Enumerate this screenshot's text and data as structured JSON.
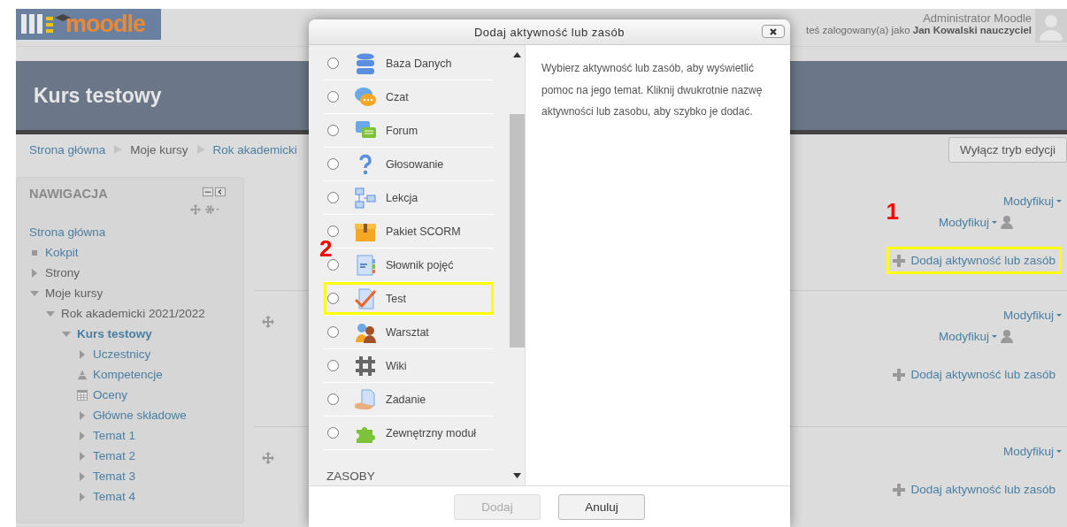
{
  "header": {
    "logo_text": "moodle",
    "user_role": "Administrator Moodle",
    "login_info": "teś zalogowany(a) jako **Jan Kowalski nauczyciel**"
  },
  "course": {
    "title": "Kurs testowy"
  },
  "breadcrumb": [
    {
      "label": "Strona główna",
      "link": true
    },
    {
      "label": "Moje kursy",
      "link": false
    },
    {
      "label": "Rok akademicki",
      "link": true
    }
  ],
  "edit_button": "Wyłącz tryb edycji",
  "navigation": {
    "title": "NAWIGACJA",
    "items": [
      {
        "label": "Strona główna",
        "kind": "plain",
        "link": true
      },
      {
        "label": "Kokpit",
        "kind": "bullet",
        "link": true
      },
      {
        "label": "Strony",
        "kind": "branch",
        "link": false,
        "expanded": false
      },
      {
        "label": "Moje kursy",
        "kind": "branch",
        "link": false,
        "expanded": true,
        "children": [
          {
            "label": "Rok akademicki 2021/2022",
            "kind": "branch",
            "link": false,
            "expanded": true,
            "children": [
              {
                "label": "Kurs testowy",
                "kind": "branch",
                "link": true,
                "expanded": true,
                "current": true,
                "children": [
                  {
                    "label": "Uczestnicy",
                    "kind": "branch",
                    "link": true,
                    "expanded": false
                  },
                  {
                    "label": "Kompetencje",
                    "kind": "competency",
                    "link": true
                  },
                  {
                    "label": "Oceny",
                    "kind": "grades",
                    "link": true
                  },
                  {
                    "label": "Główne składowe",
                    "kind": "branch",
                    "link": true,
                    "expanded": false
                  },
                  {
                    "label": "Temat 1",
                    "kind": "branch",
                    "link": true,
                    "expanded": false
                  },
                  {
                    "label": "Temat 2",
                    "kind": "branch",
                    "link": true,
                    "expanded": false
                  },
                  {
                    "label": "Temat 3",
                    "kind": "branch",
                    "link": true,
                    "expanded": false
                  },
                  {
                    "label": "Temat 4",
                    "kind": "branch",
                    "link": true,
                    "expanded": false
                  }
                ]
              }
            ]
          }
        ]
      }
    ]
  },
  "sections": [
    {
      "movable": false,
      "menus": [
        {
          "label": "Modyfikuj",
          "kind": "section"
        },
        {
          "label": "Modyfikuj",
          "kind": "role"
        }
      ],
      "add": {
        "label": "Dodaj aktywność lub zasób",
        "highlighted": true,
        "callout": "1"
      }
    },
    {
      "movable": true,
      "menus": [
        {
          "label": "Modyfikuj",
          "kind": "section"
        },
        {
          "label": "Modyfikuj",
          "kind": "role"
        }
      ],
      "add": {
        "label": "Dodaj aktywność lub zasób",
        "highlighted": false
      }
    },
    {
      "movable": true,
      "menus": [
        {
          "label": "Modyfikuj",
          "kind": "section"
        }
      ],
      "add": {
        "label": "Dodaj aktywność lub zasób",
        "highlighted": false
      }
    }
  ],
  "dialog": {
    "title": "Dodaj aktywność lub zasób",
    "activities": [
      {
        "label": "Baza Danych",
        "kind": "database",
        "selected": false,
        "highlighted": false
      },
      {
        "label": "Czat",
        "kind": "chat",
        "selected": false,
        "highlighted": false
      },
      {
        "label": "Forum",
        "kind": "forum",
        "selected": false,
        "highlighted": false
      },
      {
        "label": "Głosowanie",
        "kind": "choice",
        "selected": false,
        "highlighted": false
      },
      {
        "label": "Lekcja",
        "kind": "lesson",
        "selected": false,
        "highlighted": false
      },
      {
        "label": "Pakiet SCORM",
        "kind": "scorm",
        "selected": false,
        "highlighted": false
      },
      {
        "label": "Słownik pojęć",
        "kind": "glossary",
        "selected": false,
        "highlighted": false,
        "callout": "2"
      },
      {
        "label": "Test",
        "kind": "quiz",
        "selected": false,
        "highlighted": true
      },
      {
        "label": "Warsztat",
        "kind": "workshop",
        "selected": false,
        "highlighted": false
      },
      {
        "label": "Wiki",
        "kind": "wiki",
        "selected": false,
        "highlighted": false
      },
      {
        "label": "Zadanie",
        "kind": "assignment",
        "selected": false,
        "highlighted": false
      },
      {
        "label": "Zewnętrzny moduł",
        "kind": "lti",
        "selected": false,
        "highlighted": false
      }
    ],
    "resources_heading": "ZASOBY",
    "help": "Wybierz aktywność lub zasób, aby wyświetlić pomoc na jego temat. Kliknij dwukrotnie nazwę aktywności lub zasobu, aby szybko je dodać.",
    "buttons": [
      {
        "label": "Dodaj",
        "disabled": true
      },
      {
        "label": "Anuluj",
        "disabled": false
      }
    ]
  }
}
